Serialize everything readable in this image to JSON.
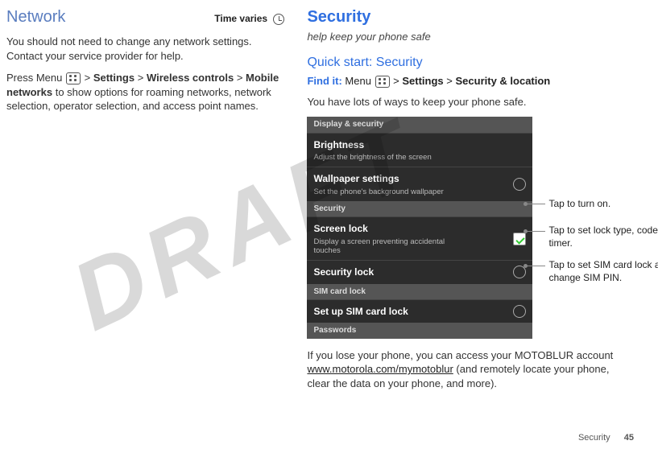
{
  "watermark": "DRAFT",
  "left": {
    "title": "Network",
    "time_badge": "Time varies",
    "para1": "You should not need to change any network settings. Contact your service provider for help.",
    "para2_pre": "Press Menu ",
    "para2_nav1": "Settings",
    "para2_nav2": "Wireless controls",
    "para2_nav3": "Mobile networks",
    "para2_post": " to show options for roaming networks, network selection, operator selection, and access point names."
  },
  "right": {
    "title": "Security",
    "tagline": "help keep your phone safe",
    "subhead": "Quick start: Security",
    "findit_label": "Find it:",
    "findit_menu": "Menu ",
    "findit_nav1": "Settings",
    "findit_nav2": "Security & location",
    "intro": "You have lots of ways to keep your phone safe.",
    "phone": {
      "header1": "Display & security",
      "item1_title": "Brightness",
      "item1_sub": "Adjust the brightness of the screen",
      "item2_title": "Wallpaper settings",
      "item2_sub": "Set the phone's background wallpaper",
      "header2": "Security",
      "item3_title": "Screen lock",
      "item3_sub": "Display a screen preventing accidental touches",
      "item4_title": "Security lock",
      "header3": "SIM card lock",
      "item5_title": "Set up SIM card lock",
      "header4": "Passwords"
    },
    "callouts": {
      "c1": "Tap to turn on.",
      "c2": "Tap to set lock type, code, and timer.",
      "c3": "Tap to set SIM card lock and change SIM PIN."
    },
    "outro_pre": "If you lose your phone, you can access your MOTOBLUR account ",
    "outro_link": "www.motorola.com/mymotoblur",
    "outro_post": " (and remotely locate your phone, clear the data on your phone, and more)."
  },
  "footer": {
    "section": "Security",
    "page": "45"
  },
  "sep": ">"
}
